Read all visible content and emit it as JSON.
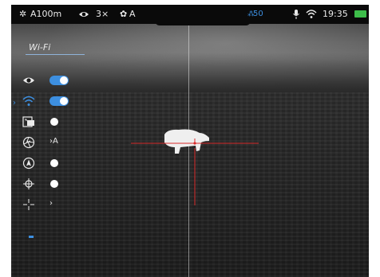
{
  "status_bar": {
    "brightness_icon": "sun-icon",
    "range_label": "A100m",
    "eye_icon": "eye-icon",
    "zoom_label": "3×",
    "calibration_label": "A",
    "signal_label": "50",
    "time": "19:35",
    "battery_color": "#3dbd4a"
  },
  "menu": {
    "title": "Wi-Fi",
    "items": [
      {
        "name": "eye-toggle",
        "icon": "eye-icon",
        "state": "on"
      },
      {
        "name": "wifi-toggle",
        "icon": "wifi-icon",
        "state": "on",
        "selected": true
      },
      {
        "name": "picture-in-picture",
        "icon": "pip-icon",
        "state": "off"
      },
      {
        "name": "aperture-mode",
        "icon": "aperture-icon",
        "value": "›A"
      },
      {
        "name": "autopilot",
        "icon": "compass-icon",
        "state": "off"
      },
      {
        "name": "reticle-toggle",
        "icon": "reticle-icon",
        "state": "off"
      },
      {
        "name": "reticle-settings",
        "icon": "crosshair-icon",
        "value": "›"
      }
    ]
  },
  "colors": {
    "accent": "#3d8fe0",
    "reticle": "#d92b2b",
    "signal": "#3d8fe0"
  }
}
